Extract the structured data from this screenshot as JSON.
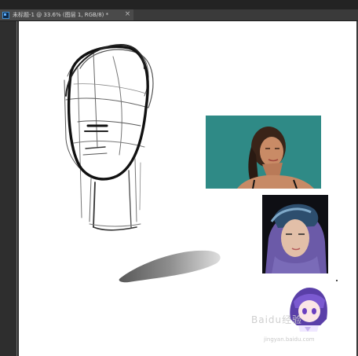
{
  "window": {
    "tab_title": "未标题-1 @ 33.6% (图层 1, RGB/8) *",
    "app_icon": "photoshop-icon",
    "close_glyph": "×",
    "panel_menu_glyph": "«"
  },
  "canvas": {
    "background": "#ffffff",
    "reference_images": [
      {
        "name": "woman-portrait",
        "background": "#2f8a86"
      },
      {
        "name": "man-portrait",
        "background": "#0e0f14"
      },
      {
        "name": "anime-girl",
        "background": "#ffffff"
      }
    ]
  },
  "watermark": {
    "text": "Baidu经验",
    "url": "jingyan.baidu.com"
  }
}
